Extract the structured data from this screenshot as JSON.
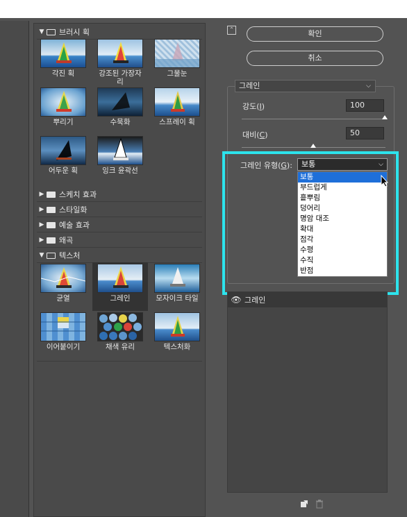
{
  "gallery": {
    "categories": {
      "brush": {
        "label": "브러시 획"
      },
      "sketch": {
        "label": "스케치 효과"
      },
      "stylize": {
        "label": "스타일화"
      },
      "artistic": {
        "label": "예술 효과"
      },
      "distort": {
        "label": "왜곡"
      },
      "texture": {
        "label": "텍스처"
      }
    },
    "brush_thumbs": [
      {
        "label": "각진 획"
      },
      {
        "label": "강조된 가장자\n리"
      },
      {
        "label": "그물눈"
      },
      {
        "label": "뿌리기"
      },
      {
        "label": "수묵화"
      },
      {
        "label": "스프레이 획"
      },
      {
        "label": "어두운 획"
      },
      {
        "label": "잉크 윤곽선"
      }
    ],
    "texture_thumbs": [
      {
        "label": "균열"
      },
      {
        "label": "그레인"
      },
      {
        "label": "모자이크 타일"
      },
      {
        "label": "이어붙이기"
      },
      {
        "label": "채색 유리"
      },
      {
        "label": "텍스처화"
      }
    ]
  },
  "buttons": {
    "ok": "확인",
    "cancel": "취소"
  },
  "filter_select": {
    "value": "그레인"
  },
  "params": {
    "intensity": {
      "label_prefix": "강도(",
      "mnemonic": "I",
      "label_suffix": ")",
      "value": "100",
      "level": 100
    },
    "contrast": {
      "label_prefix": "대비(",
      "mnemonic": "C",
      "label_suffix": ")",
      "value": "50",
      "level": 50
    },
    "grain_type": {
      "label_prefix": "그레인 유형(",
      "mnemonic": "G",
      "label_suffix": "):",
      "value": "보통"
    }
  },
  "grain_options": [
    "보통",
    "부드럽게",
    "흩뿌림",
    "덩어리",
    "명암 대조",
    "확대",
    "점각",
    "수평",
    "수직",
    "반점"
  ],
  "layer": {
    "name": "그레인"
  },
  "colors": {
    "highlight": "#2de3ec",
    "selected_option": "#1e6fd9",
    "panel": "#535353"
  }
}
